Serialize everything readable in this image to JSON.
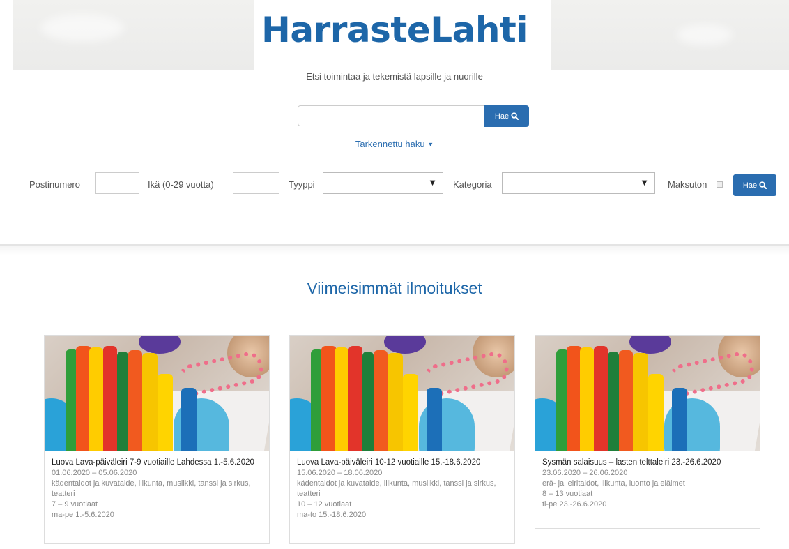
{
  "header": {
    "logo_part1": "Harraste",
    "logo_part2": "Lahti",
    "tagline": "Etsi toimintaa ja tekemistä lapsille ja nuorille"
  },
  "search": {
    "value": "",
    "button_label": "Hae",
    "advanced_label": "Tarkennettu haku"
  },
  "filters": {
    "postal_label": "Postinumero",
    "age_label": "Ikä (0-29 vuotta)",
    "type_label": "Tyyppi",
    "category_label": "Kategoria",
    "free_label": "Maksuton",
    "button_label": "Hae"
  },
  "section": {
    "title": "Viimeisimmät ilmoitukset"
  },
  "cards": [
    {
      "title": "Luova Lava-päiväleiri 7-9 vuotiaille Lahdessa 1.-5.6.2020",
      "dates": "01.06.2020 – 05.06.2020",
      "categories": "kädentaidot ja kuvataide, liikunta, musiikki, tanssi ja sirkus, teatteri",
      "ages": "7 – 9 vuotiaat",
      "days": "ma-pe 1.-5.6.2020"
    },
    {
      "title": "Luova Lava-päiväleiri 10-12 vuotiaille 15.-18.6.2020",
      "dates": "15.06.2020 – 18.06.2020",
      "categories": "kädentaidot ja kuvataide, liikunta, musiikki, tanssi ja sirkus, teatteri",
      "ages": "10 – 12 vuotiaat",
      "days": "ma-to 15.-18.6.2020"
    },
    {
      "title": "Sysmän salaisuus – lasten telttaleiri 23.-26.6.2020",
      "dates": "23.06.2020 – 26.06.2020",
      "categories": "erä- ja leiritaidot, liikunta, luonto ja eläimet",
      "ages": "8 – 13 vuotiaat",
      "days": "ti-pe 23.-26.6.2020"
    }
  ]
}
